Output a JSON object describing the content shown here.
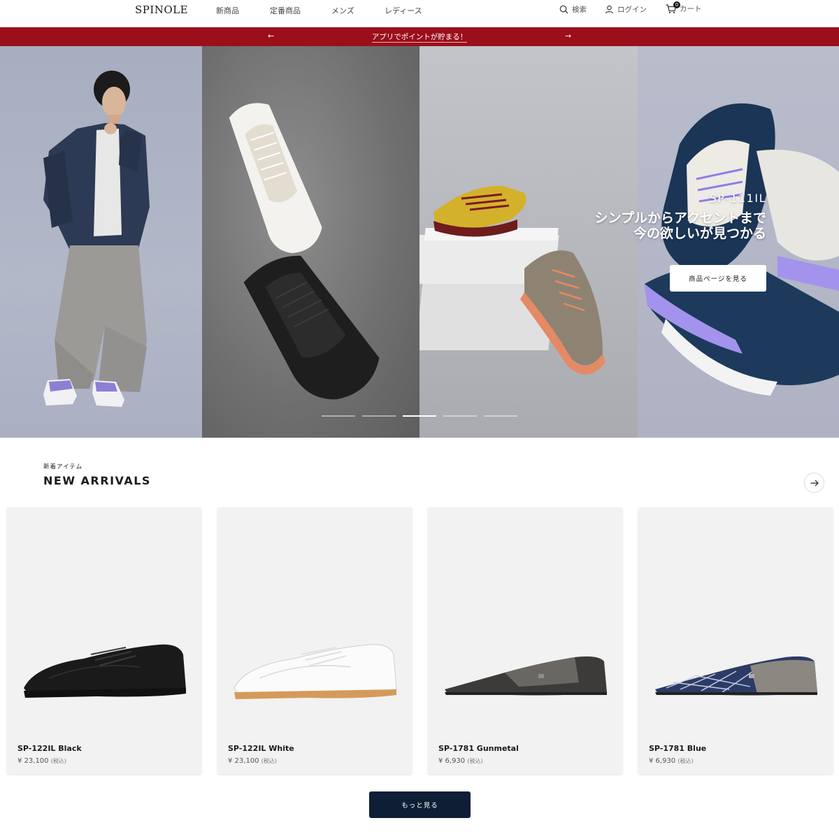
{
  "header": {
    "logo": "SPINOLE",
    "nav": [
      "新商品",
      "定番商品",
      "メンズ",
      "レディース"
    ],
    "search_label": "検索",
    "login_label": "ログイン",
    "cart_label": "カート",
    "cart_count": "0"
  },
  "announcement": {
    "text": "アプリでポイントが貯まる！",
    "prev": "←",
    "next": "→"
  },
  "hero": {
    "model": "SP-111IL",
    "tagline_line1": "シンプルからアクセントまで",
    "tagline_line2": "今の欲しいが見つかる",
    "button_label": "商品ページを見る",
    "slide_count": 5,
    "active_slide": 3
  },
  "new_arrivals": {
    "subtitle": "新着アイテム",
    "title": "NEW ARRIVALS",
    "products": [
      {
        "name": "SP-122IL Black",
        "price": "¥ 23,100",
        "tax": "(税込)"
      },
      {
        "name": "SP-122IL White",
        "price": "¥ 23,100",
        "tax": "(税込)"
      },
      {
        "name": "SP-1781 Gunmetal",
        "price": "¥ 6,930",
        "tax": "(税込)"
      },
      {
        "name": "SP-1781 Blue",
        "price": "¥ 6,930",
        "tax": "(税込)"
      }
    ],
    "more_label": "もっと見る"
  },
  "colors": {
    "announcement_bg": "#9b0f1a",
    "primary_button": "#0d1e35",
    "card_bg": "#f2f2f2"
  }
}
